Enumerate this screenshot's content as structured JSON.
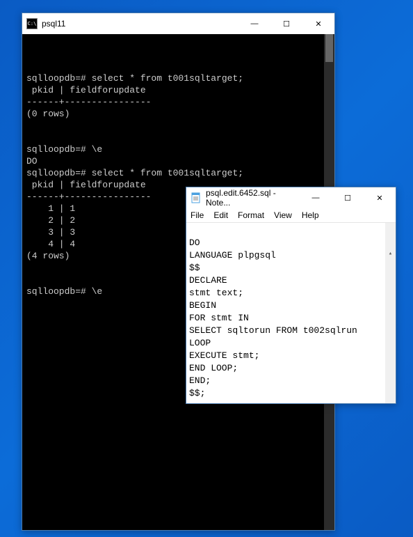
{
  "terminal": {
    "title": "psql11",
    "lines": [
      "",
      "",
      "sqlloopdb=# select * from t001sqltarget;",
      " pkid | fieldforupdate",
      "------+----------------",
      "(0 rows)",
      "",
      "",
      "sqlloopdb=# \\e",
      "DO",
      "sqlloopdb=# select * from t001sqltarget;",
      " pkid | fieldforupdate",
      "------+----------------",
      "    1 | 1",
      "    2 | 2",
      "    3 | 3",
      "    4 | 4",
      "(4 rows)",
      "",
      "",
      "sqlloopdb=# \\e"
    ]
  },
  "notepad": {
    "title": "psql.edit.6452.sql - Note...",
    "menu": {
      "file": "File",
      "edit": "Edit",
      "format": "Format",
      "view": "View",
      "help": "Help"
    },
    "lines": [
      "DO",
      "LANGUAGE plpgsql",
      "$$",
      "DECLARE",
      "stmt text;",
      "BEGIN",
      "FOR stmt IN",
      "SELECT sqltorun FROM t002sqlrun",
      "LOOP",
      "EXECUTE stmt;",
      "END LOOP;",
      "END;",
      "$$;"
    ]
  },
  "win_controls": {
    "min": "—",
    "max": "☐",
    "close": "✕"
  }
}
